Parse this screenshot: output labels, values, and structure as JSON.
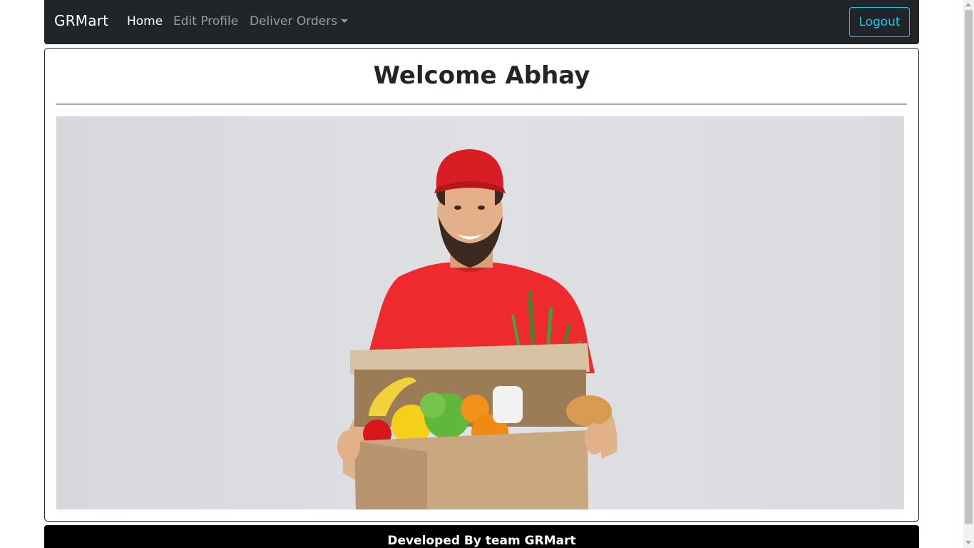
{
  "navbar": {
    "brand": "GRMart",
    "links": [
      {
        "label": "Home",
        "active": true
      },
      {
        "label": "Edit Profile",
        "active": false
      },
      {
        "label": "Deliver Orders",
        "active": false
      }
    ],
    "logout_label": "Logout",
    "colors": {
      "background": "#212529",
      "accent": "#0dcaf0"
    }
  },
  "main": {
    "welcome_text": "Welcome Abhay",
    "hero_image": "delivery-person-holding-grocery-box"
  },
  "footer": {
    "text": "Developed By team GRMart"
  }
}
